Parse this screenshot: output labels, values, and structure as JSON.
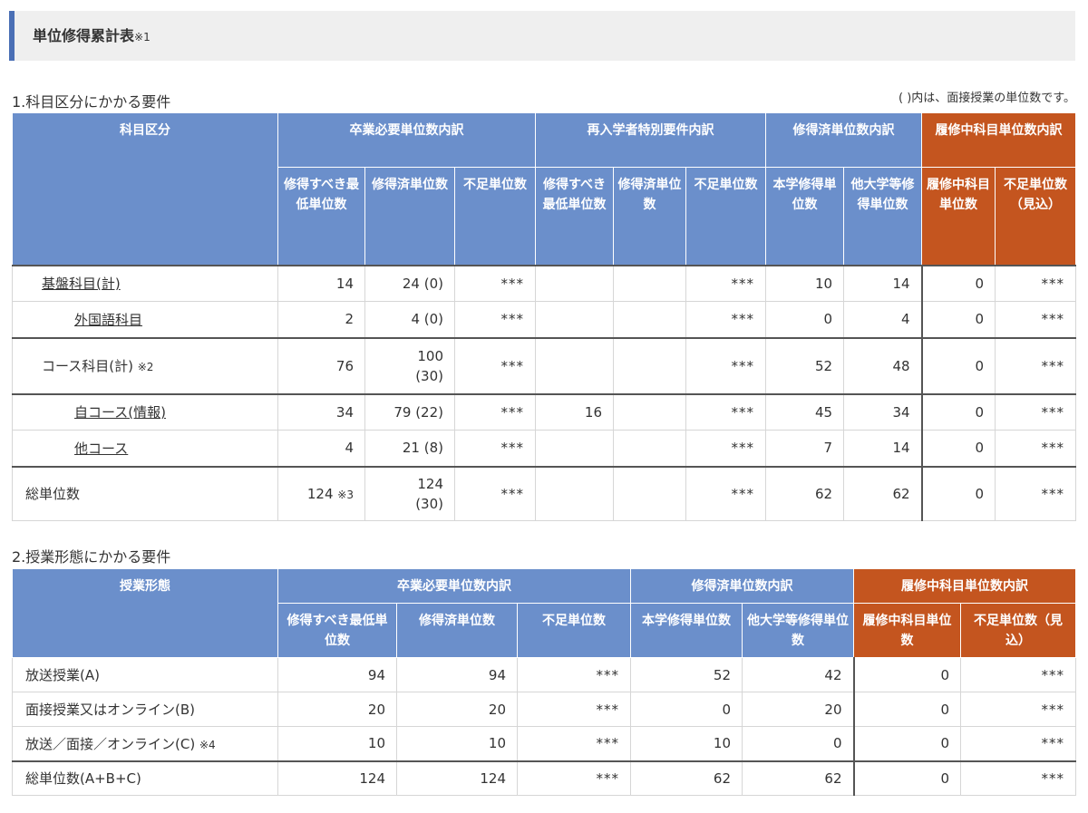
{
  "page": {
    "title": "単位修得累計表",
    "title_note": "※1"
  },
  "section1": {
    "title": "1.科目区分にかかる要件",
    "note": "( )内は、面接授業の単位数です。",
    "headers": {
      "category": "科目区分",
      "group_required": "卒業必要単位数内訳",
      "group_readmit": "再入学者特別要件内訳",
      "group_earned": "修得済単位数内訳",
      "group_inprogress": "履修中科目単位数内訳",
      "req_min": "修得すべき最低単位数",
      "req_earned": "修得済単位数",
      "req_short": "不足単位数",
      "re_min": "修得すべき最低単位数",
      "re_earned": "修得済単位数",
      "re_short": "不足単位数",
      "earned_own": "本学修得単位数",
      "earned_other": "他大学等修得単位数",
      "ip_units": "履修中科目単位数",
      "ip_short": "不足単位数（見込）"
    },
    "rows": [
      {
        "label": "基盤科目(計)",
        "note": "",
        "min": "14",
        "earned": "24 (0)",
        "short": "***",
        "re_min": "",
        "re_earned": "",
        "re_short": "***",
        "own": "10",
        "other": "14",
        "ip": "0",
        "ip_short": "***"
      },
      {
        "label": "外国語科目",
        "note": "",
        "min": "2",
        "earned": "4 (0)",
        "short": "***",
        "re_min": "",
        "re_earned": "",
        "re_short": "***",
        "own": "0",
        "other": "4",
        "ip": "0",
        "ip_short": "***"
      },
      {
        "label": "コース科目(計)",
        "note": "※2",
        "min": "76",
        "earned_line1": "100",
        "earned_line2": "(30)",
        "short": "***",
        "re_min": "",
        "re_earned": "",
        "re_short": "***",
        "own": "52",
        "other": "48",
        "ip": "0",
        "ip_short": "***"
      },
      {
        "label": "自コース(情報)",
        "note": "",
        "min": "34",
        "earned": "79 (22)",
        "short": "***",
        "re_min": "16",
        "re_earned": "",
        "re_short": "***",
        "own": "45",
        "other": "34",
        "ip": "0",
        "ip_short": "***"
      },
      {
        "label": "他コース",
        "note": "",
        "min": "4",
        "earned": "21 (8)",
        "short": "***",
        "re_min": "",
        "re_earned": "",
        "re_short": "***",
        "own": "7",
        "other": "14",
        "ip": "0",
        "ip_short": "***"
      },
      {
        "label": "総単位数",
        "note": "",
        "min": "124",
        "min_note": "※3",
        "earned_line1": "124",
        "earned_line2": "(30)",
        "short": "***",
        "re_min": "",
        "re_earned": "",
        "re_short": "***",
        "own": "62",
        "other": "62",
        "ip": "0",
        "ip_short": "***"
      }
    ]
  },
  "section2": {
    "title": "2.授業形態にかかる要件",
    "headers": {
      "form": "授業形態",
      "group_required": "卒業必要単位数内訳",
      "group_earned": "修得済単位数内訳",
      "group_inprogress": "履修中科目単位数内訳",
      "req_min": "修得すべき最低単位数",
      "req_earned": "修得済単位数",
      "req_short": "不足単位数",
      "earned_own": "本学修得単位数",
      "earned_other": "他大学等修得単位数",
      "ip_units": "履修中科目単位数",
      "ip_short": "不足単位数（見込）"
    },
    "rows": [
      {
        "label": "放送授業(A)",
        "note": "",
        "min": "94",
        "earned": "94",
        "short": "***",
        "own": "52",
        "other": "42",
        "ip": "0",
        "ip_short": "***"
      },
      {
        "label": "面接授業又はオンライン(B)",
        "note": "",
        "min": "20",
        "earned": "20",
        "short": "***",
        "own": "0",
        "other": "20",
        "ip": "0",
        "ip_short": "***"
      },
      {
        "label": "放送／面接／オンライン(C)",
        "note": "※4",
        "min": "10",
        "earned": "10",
        "short": "***",
        "own": "10",
        "other": "0",
        "ip": "0",
        "ip_short": "***"
      },
      {
        "label": "総単位数(A+B+C)",
        "note": "",
        "min": "124",
        "earned": "124",
        "short": "***",
        "own": "62",
        "other": "62",
        "ip": "0",
        "ip_short": "***"
      }
    ]
  },
  "colors": {
    "header_blue": "#6b8fcb",
    "header_orange": "#c4551f",
    "accent_bar": "#4a6fb5",
    "title_bg": "#efefef"
  }
}
